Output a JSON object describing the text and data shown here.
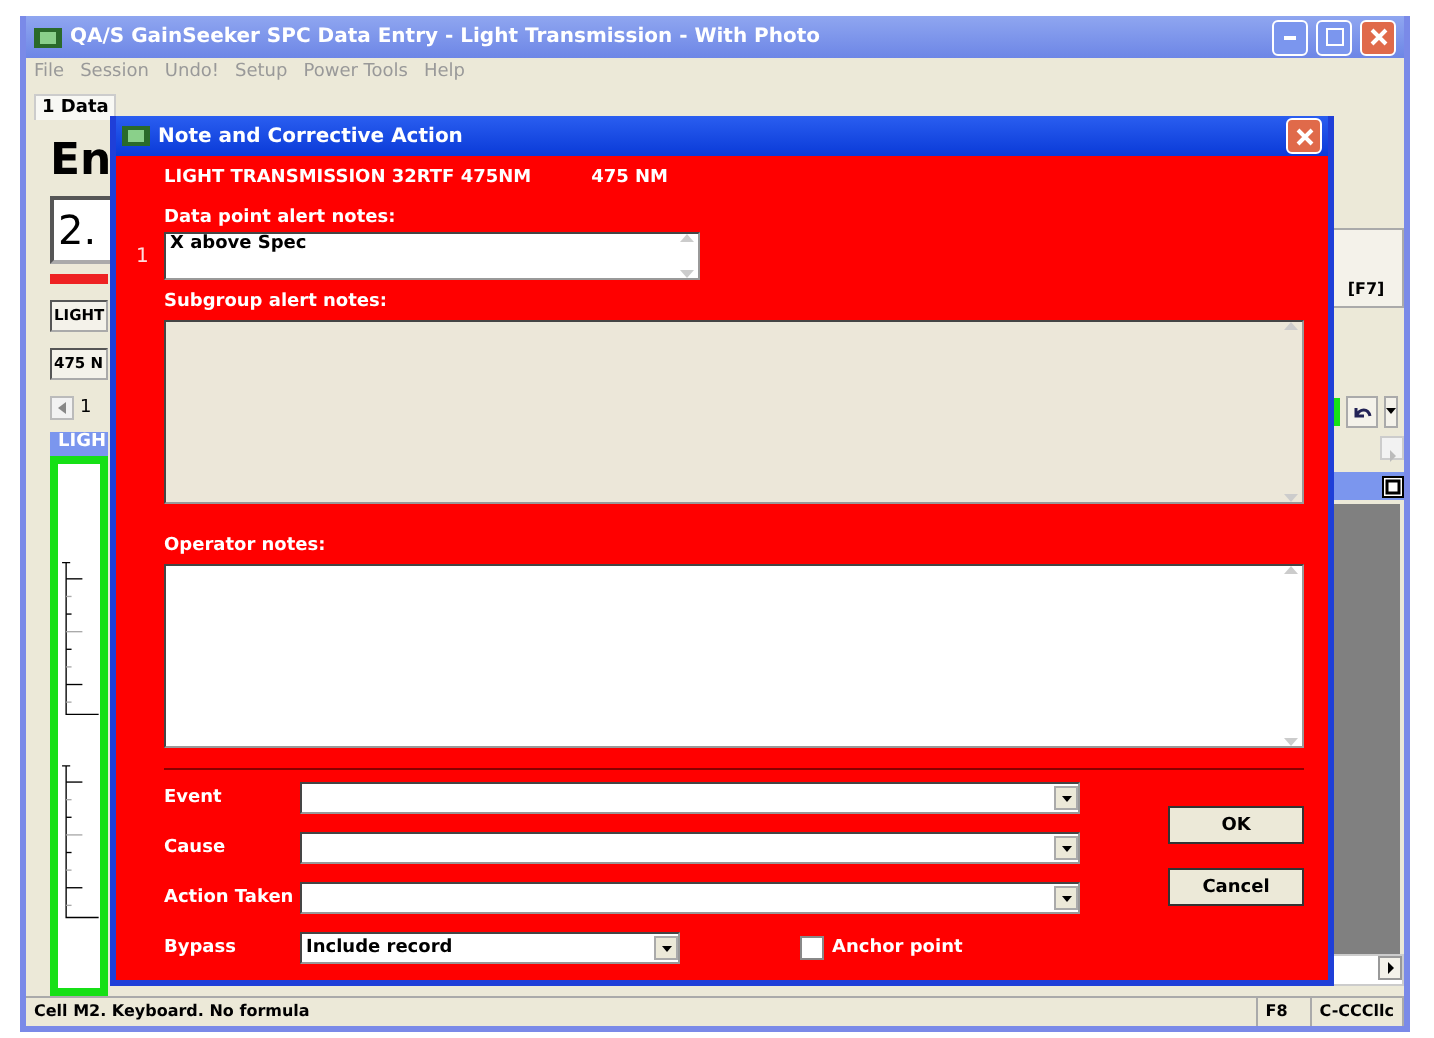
{
  "window": {
    "title": "QA/S GainSeeker SPC Data Entry - Light Transmission - With Photo"
  },
  "menu": [
    "File",
    "Session",
    "Undo!",
    "Setup",
    "Power Tools",
    "Help"
  ],
  "tabs": [
    {
      "label": "1 Data",
      "selected": true
    }
  ],
  "background": {
    "heading": "En",
    "value": "2.",
    "fields": [
      "LIGHT",
      "475 N"
    ],
    "page": "1",
    "panel_title": "LIGH",
    "f7_button": "[F7]"
  },
  "dialog": {
    "title": "Note and Corrective Action",
    "header": [
      "LIGHT TRANSMISSION 32RTF 475NM",
      "475 NM"
    ],
    "data_point": {
      "label": "Data point alert notes:",
      "row": "1",
      "value": "X above Spec"
    },
    "subgroup": {
      "label": "Subgroup alert notes:",
      "disabled": true
    },
    "operator": {
      "label": "Operator notes:",
      "disabled": false
    },
    "combos": [
      {
        "label": "Event"
      },
      {
        "label": "Cause"
      },
      {
        "label": "Action Taken"
      }
    ],
    "bypass": {
      "label": "Bypass",
      "value": "Include record"
    },
    "anchor": {
      "label": "Anchor point",
      "checked": false
    },
    "buttons": [
      "OK",
      "Cancel"
    ]
  },
  "status_bar": [
    "Cell M2. Keyboard. No formula",
    "F8",
    "C-CCCllc"
  ]
}
